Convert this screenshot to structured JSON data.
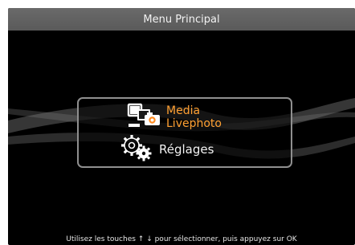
{
  "header": {
    "title": "Menu Principal"
  },
  "menu": {
    "items": [
      {
        "label_line1": "Media",
        "label_line2": "Livephoto",
        "icon": "media-livephoto-icon",
        "color": "#ffa032",
        "selected": true
      },
      {
        "label": "Réglages",
        "icon": "settings-gears-icon",
        "color": "#f4f4f4"
      }
    ]
  },
  "footer": {
    "hint": "Utilisez les touches ↑ ↓ pour sélectionner, puis appuyez sur OK"
  }
}
